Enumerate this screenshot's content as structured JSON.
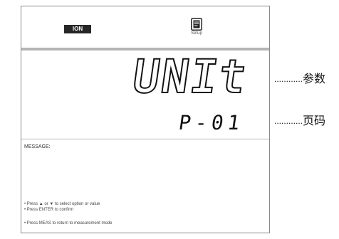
{
  "status_bar": {
    "mode_badge": "ION",
    "setup_label": "Setup",
    "setup_icon": "document-icon"
  },
  "display": {
    "parameter": "UNIt",
    "page": "P-01"
  },
  "message": {
    "title": "MESSAGE:",
    "hints": [
      "• Press ▲ or ▼ to select option or value",
      "• Press ENTER to confirm",
      "• Press MEAS to return to measurement mode"
    ]
  },
  "annotations": {
    "parameter_label": "参数",
    "page_label": "页码",
    "leader": "............"
  }
}
